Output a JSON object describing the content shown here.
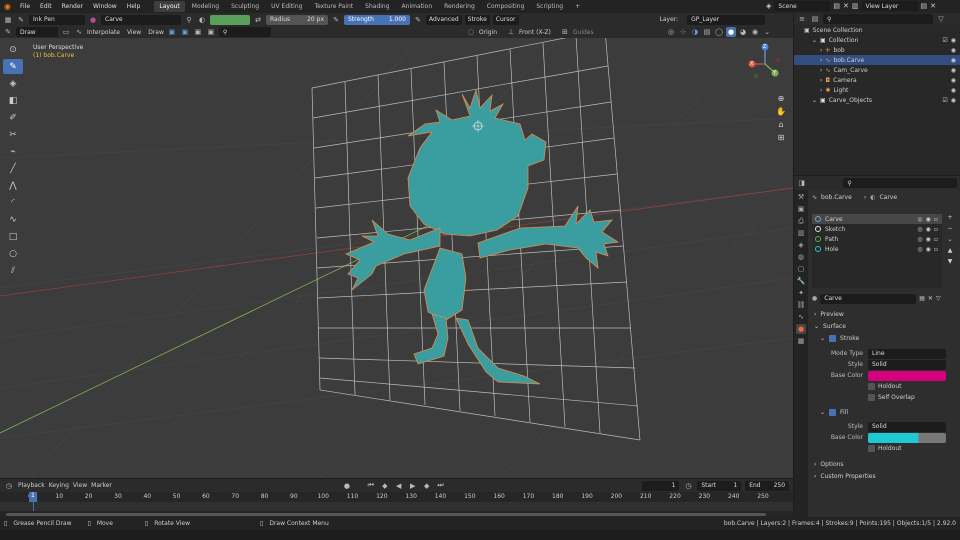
{
  "menu": [
    "File",
    "Edit",
    "Render",
    "Window",
    "Help"
  ],
  "workspaces": [
    "Layout",
    "Modeling",
    "Sculpting",
    "UV Editing",
    "Texture Paint",
    "Shading",
    "Animation",
    "Rendering",
    "Compositing",
    "Scripting"
  ],
  "workspace_add": "+",
  "scene": {
    "name": "Scene",
    "view_layer": "View Layer"
  },
  "tool_header": {
    "brush": "Ink Pen",
    "material": "Carve",
    "radius_label": "Radius",
    "radius_value": "20 px",
    "strength_label": "Strength",
    "strength_value": "1.000",
    "advanced": "Advanced",
    "stroke": "Stroke",
    "cursor": "Cursor",
    "layer_label": "Layer:",
    "layer_value": "GP_Layer"
  },
  "viewport_header": {
    "mode": "Draw",
    "interpolate": "Interpolate",
    "view": "View",
    "draw": "Draw",
    "origin": "Origin",
    "front": "Front (X-Z)",
    "guides": "Guides"
  },
  "viewport": {
    "perspective": "User Perspective",
    "object_label": "(1) bob.Carve",
    "axis_x": "X",
    "axis_y": "Y",
    "axis_z": "Z"
  },
  "timeline": {
    "playback": "Playback",
    "keying": "Keying",
    "view": "View",
    "marker": "Marker",
    "current_frame": "1",
    "start_label": "Start",
    "start": "1",
    "end_label": "End",
    "end": "250",
    "ruler": [
      "0",
      "10",
      "20",
      "30",
      "40",
      "50",
      "60",
      "70",
      "80",
      "90",
      "100",
      "110",
      "120",
      "130",
      "140",
      "150",
      "160",
      "170",
      "180",
      "190",
      "200",
      "210",
      "220",
      "230",
      "240",
      "250"
    ],
    "playhead": "1"
  },
  "status": {
    "select": "Grease Pencil Draw",
    "move": "Move",
    "rotate": "Rotate View",
    "context": "Draw Context Menu",
    "stats": "bob.Carve | Layers:2 | Frames:4 | Strokes:9 | Points:195 | Objects:1/5 | 2.92.0"
  },
  "outliner": {
    "root": "Scene Collection",
    "items": [
      {
        "name": "Collection",
        "depth": 1,
        "icon": "collection-icon",
        "color": "#e0e0e0"
      },
      {
        "name": "bob",
        "depth": 2,
        "icon": "empty-icon",
        "color": "#e6a24d"
      },
      {
        "name": "bob.Carve",
        "depth": 2,
        "icon": "gpencil-icon",
        "color": "#e6a24d",
        "selected": true
      },
      {
        "name": "Cam_Carve",
        "depth": 2,
        "icon": "gpencil-icon",
        "color": "#e6a24d"
      },
      {
        "name": "Camera",
        "depth": 2,
        "icon": "camera-icon",
        "color": "#e6a24d"
      },
      {
        "name": "Light",
        "depth": 2,
        "icon": "light-icon",
        "color": "#e6a24d"
      },
      {
        "name": "Carve_Objects",
        "depth": 1,
        "icon": "collection-icon",
        "color": "#e0e0e0"
      }
    ]
  },
  "properties": {
    "object": "bob.Carve",
    "material_tab": "Carve",
    "materials": [
      {
        "name": "Carve",
        "color": "#6fa8dc",
        "selected": true
      },
      {
        "name": "Sketch",
        "color": "#e0e0e0"
      },
      {
        "name": "Path",
        "color": "#4caf50"
      },
      {
        "name": "Hole",
        "color": "#1ec9c9"
      }
    ],
    "material_slot": "Carve",
    "sections": {
      "preview": "Preview",
      "surface": "Surface",
      "stroke": "Stroke",
      "fill": "Fill",
      "options": "Options",
      "custom": "Custom Properties"
    },
    "stroke_fields": {
      "mode_type_label": "Mode Type",
      "mode_type": "Line",
      "style_label": "Style",
      "style": "Solid",
      "base_color_label": "Base Color",
      "base_color": "#d4007d",
      "holdout": "Holdout",
      "self_overlap": "Self Overlap"
    },
    "fill_fields": {
      "style_label": "Style",
      "style": "Solid",
      "base_color_label": "Base Color",
      "base_color": "#1ec9d4",
      "holdout": "Holdout"
    }
  },
  "colors": {
    "accent": "#4772b3",
    "figure": "#3a9ea0",
    "figure_outline": "#e08a4a",
    "header": "#2b2b2b"
  }
}
